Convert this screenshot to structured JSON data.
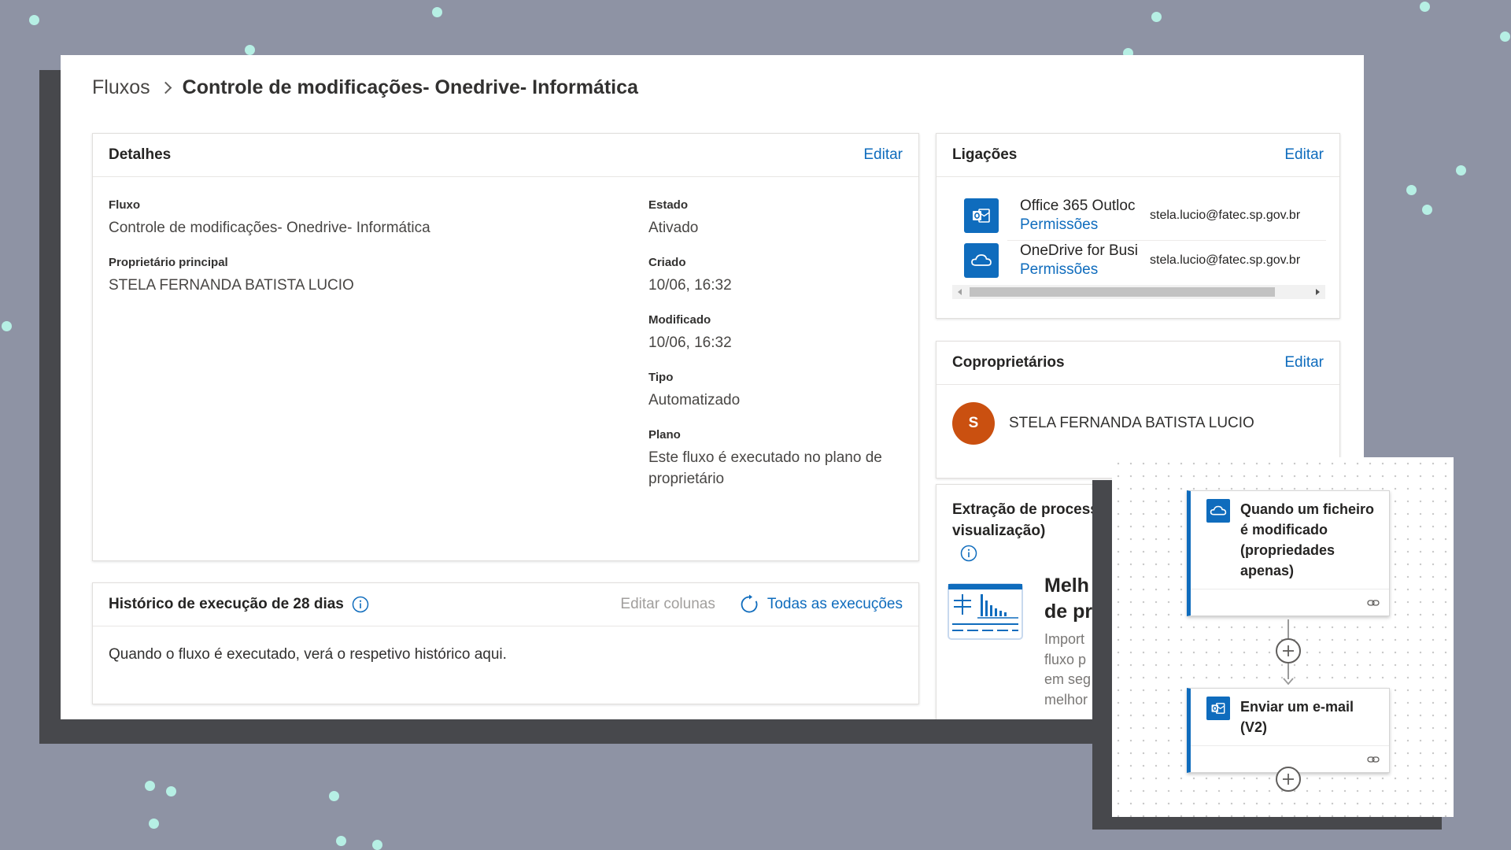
{
  "breadcrumb": {
    "root": "Fluxos",
    "current": "Controle de modificações- Onedrive- Informática"
  },
  "details": {
    "title": "Detalhes",
    "edit": "Editar",
    "flow_label": "Fluxo",
    "flow_value": "Controle de modificações- Onedrive- Informática",
    "owner_label": "Proprietário principal",
    "owner_value": "STELA FERNANDA BATISTA LUCIO",
    "state_label": "Estado",
    "state_value": "Ativado",
    "created_label": "Criado",
    "created_value": "10/06, 16:32",
    "modified_label": "Modificado",
    "modified_value": "10/06, 16:32",
    "type_label": "Tipo",
    "type_value": "Automatizado",
    "plan_label": "Plano",
    "plan_value": "Este fluxo é executado no plano de proprietário"
  },
  "history": {
    "title": "Histórico de execução de 28 dias",
    "edit_columns": "Editar colunas",
    "all_runs": "Todas as execuções",
    "empty_message": "Quando o fluxo é executado, verá o respetivo histórico aqui."
  },
  "connections": {
    "title": "Ligações",
    "edit": "Editar",
    "items": [
      {
        "name": "Office 365 Outloc",
        "permissions": "Permissões",
        "email": "stela.lucio@fatec.sp.gov.br",
        "icon": "outlook-icon"
      },
      {
        "name": "OneDrive for Busi",
        "permissions": "Permissões",
        "email": "stela.lucio@fatec.sp.gov.br",
        "icon": "onedrive-icon"
      }
    ]
  },
  "coowners": {
    "title": "Coproprietários",
    "edit": "Editar",
    "avatar_initial": "S",
    "name": "STELA FERNANDA BATISTA LUCIO"
  },
  "process_mining": {
    "title_line1": "Extração de process",
    "title_line2": "visualização)",
    "promo_title_line1": "Melh",
    "promo_title_line2": "de pr",
    "promo_text_lines": [
      "Import",
      "fluxo p",
      "em seg",
      "melhor"
    ]
  },
  "flow_designer": {
    "trigger": {
      "title": "Quando um ficheiro é modificado (propriedades apenas)",
      "icon": "onedrive-icon"
    },
    "action": {
      "title": "Enviar um e-mail (V2)",
      "icon": "outlook-icon"
    }
  },
  "colors": {
    "background": "#8e93a4",
    "accent": "#0f6cbd",
    "avatar": "#ca5010",
    "decor_dots": "#b6efe4"
  }
}
